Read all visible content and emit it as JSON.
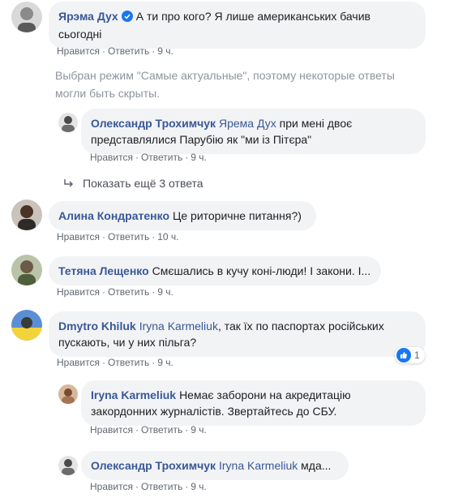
{
  "actions": {
    "like": "Нравится",
    "reply": "Ответить",
    "dot": "·"
  },
  "notice": "Выбран режим \"Самые актуальные\", поэтому некоторые ответы могли быть скрыты.",
  "show_more": "Показать ещё 3 ответа",
  "comments": [
    {
      "author": "Ярэма Дух",
      "verified": true,
      "mention": "",
      "text": "А ти про кого? Я лише американських бачив сьогодні",
      "time": "9 ч."
    },
    {
      "author": "Олександр Трохимчук",
      "mention": "Ярема Дух",
      "text": "при мені двоє представлялися Парубію як \"ми із Пітєра\"",
      "time": "9 ч."
    },
    {
      "author": "Алина Кондратенко",
      "mention": "",
      "text": "Це риторичне питання?)",
      "time": "10 ч."
    },
    {
      "author": "Тетяна Лещенко",
      "mention": "",
      "text": "Смєшались в кучу коні-люди! І закони. І...",
      "time": "9 ч."
    },
    {
      "author": "Dmytro Khiluk",
      "mention": "Iryna Karmeliuk",
      "text": ", так їх по паспортах російських пускають, чи у них пільга?",
      "time": "9 ч.",
      "reactions": "1"
    },
    {
      "author": "Iryna Karmeliuk",
      "mention": "",
      "text": "Немає заборони на акредитацію закордонних журналістів. Звертайтесь до СБУ.",
      "time": "9 ч."
    },
    {
      "author": "Олександр Трохимчук",
      "mention": "Iryna Karmeliuk",
      "text": "мда...",
      "time": "9 ч."
    }
  ],
  "colors": {
    "link": "#385898",
    "bubble": "#f2f3f5",
    "meta": "#606770",
    "like_blue": "#1877f2"
  },
  "icons": [
    "verified-badge-icon",
    "reply-arrow-icon",
    "like-reaction-icon"
  ]
}
